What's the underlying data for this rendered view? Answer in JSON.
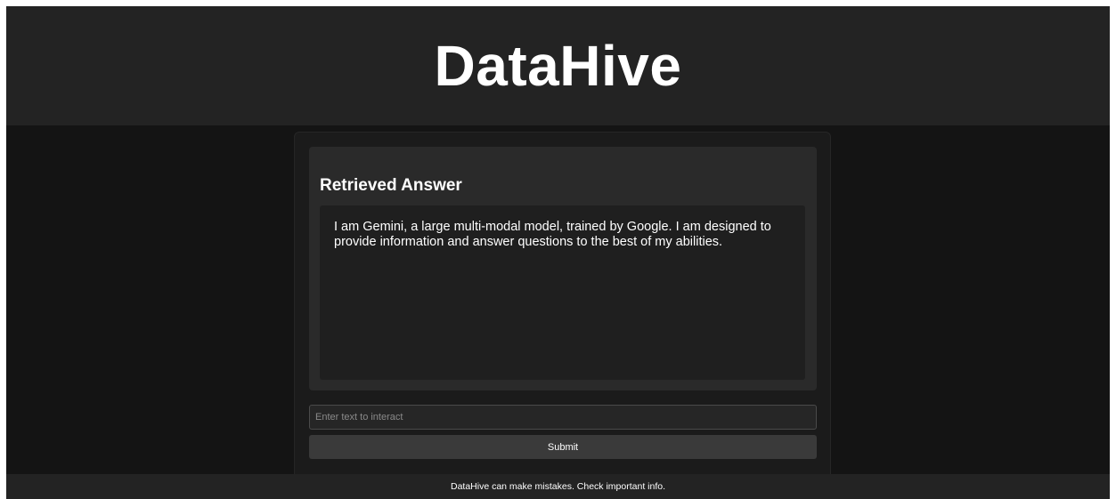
{
  "app": {
    "title": "DataHive"
  },
  "answer": {
    "heading": "Retrieved Answer",
    "text": "I am Gemini, a large multi-modal model, trained by Google. I am designed to provide information and answer questions to the best of my abilities."
  },
  "input": {
    "placeholder": "Enter text to interact",
    "value": ""
  },
  "submit": {
    "label": "Submit"
  },
  "footer": {
    "disclaimer": "DataHive can make mistakes. Check important info."
  },
  "colors": {
    "page_background": "#141414",
    "header_background": "#232323",
    "panel_background": "#1b1b1b",
    "card_background": "#2a2a2a",
    "answer_box_background": "#1f1f1f",
    "button_background": "#3a3a3a",
    "text": "#ffffff",
    "placeholder_text": "#8a8a8a"
  }
}
